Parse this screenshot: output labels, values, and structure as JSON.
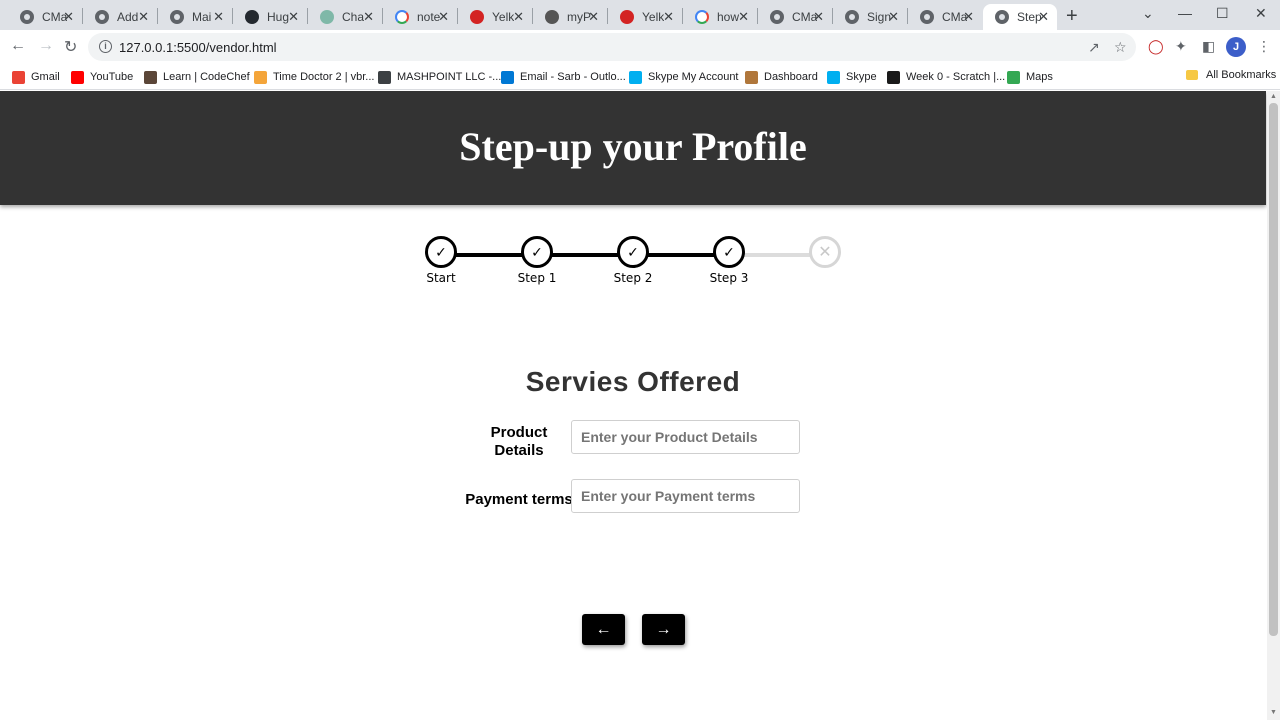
{
  "browser": {
    "tabs": [
      {
        "title": "CMa",
        "favicon": "chrome-globe-icon"
      },
      {
        "title": "Add",
        "favicon": "chrome-globe-icon"
      },
      {
        "title": "Mai",
        "favicon": "chrome-globe-icon"
      },
      {
        "title": "Hug",
        "favicon": "github-icon"
      },
      {
        "title": "Cha",
        "favicon": "chatgpt-icon"
      },
      {
        "title": "note",
        "favicon": "google-icon"
      },
      {
        "title": "Yelk",
        "favicon": "yelp-icon"
      },
      {
        "title": "myP",
        "favicon": "myp-icon"
      },
      {
        "title": "Yelk",
        "favicon": "yelp-icon"
      },
      {
        "title": "how",
        "favicon": "google-icon"
      },
      {
        "title": "CMa",
        "favicon": "chrome-globe-icon"
      },
      {
        "title": "Sign",
        "favicon": "chrome-globe-icon"
      },
      {
        "title": "CMa",
        "favicon": "chrome-globe-icon"
      },
      {
        "title": "Step",
        "favicon": "chrome-globe-icon"
      }
    ],
    "url": "127.0.0.1:5500/vendor.html",
    "profile_initial": "J",
    "bookmarks": [
      {
        "label": "Gmail",
        "color": "#ea4335"
      },
      {
        "label": "YouTube",
        "color": "#ff0000"
      },
      {
        "label": "Learn | CodeChef",
        "color": "#5b4638"
      },
      {
        "label": "Time Doctor 2 | vbr...",
        "color": "#f4a53a"
      },
      {
        "label": "MASHPOINT LLC -...",
        "color": "#3c4043"
      },
      {
        "label": "Email - Sarb - Outlo...",
        "color": "#0078d4"
      },
      {
        "label": "Skype My Account",
        "color": "#00aff0"
      },
      {
        "label": "Dashboard",
        "color": "#b0773b"
      },
      {
        "label": "Skype",
        "color": "#00aff0"
      },
      {
        "label": "Week 0 - Scratch |...",
        "color": "#1a1a1a"
      },
      {
        "label": "Maps",
        "color": "#34a853"
      }
    ],
    "all_bookmarks": "All Bookmarks"
  },
  "page": {
    "title": "Step-up your Profile",
    "steps": [
      {
        "label": "Start",
        "state": "complete",
        "icon": "check-icon"
      },
      {
        "label": "Step 1",
        "state": "complete",
        "icon": "check-icon"
      },
      {
        "label": "Step 2",
        "state": "complete",
        "icon": "check-icon"
      },
      {
        "label": "Step 3",
        "state": "complete",
        "icon": "check-icon"
      },
      {
        "label": "",
        "state": "pending",
        "icon": "cross-icon"
      }
    ],
    "section_title": "Servies Offered",
    "fields": {
      "product": {
        "label": "Product Details",
        "placeholder": "Enter your Product Details",
        "value": ""
      },
      "payment": {
        "label": "Payment terms",
        "placeholder": "Enter your Payment terms",
        "value": ""
      }
    },
    "buttons": {
      "prev": "🡐",
      "next": "🡒"
    }
  }
}
